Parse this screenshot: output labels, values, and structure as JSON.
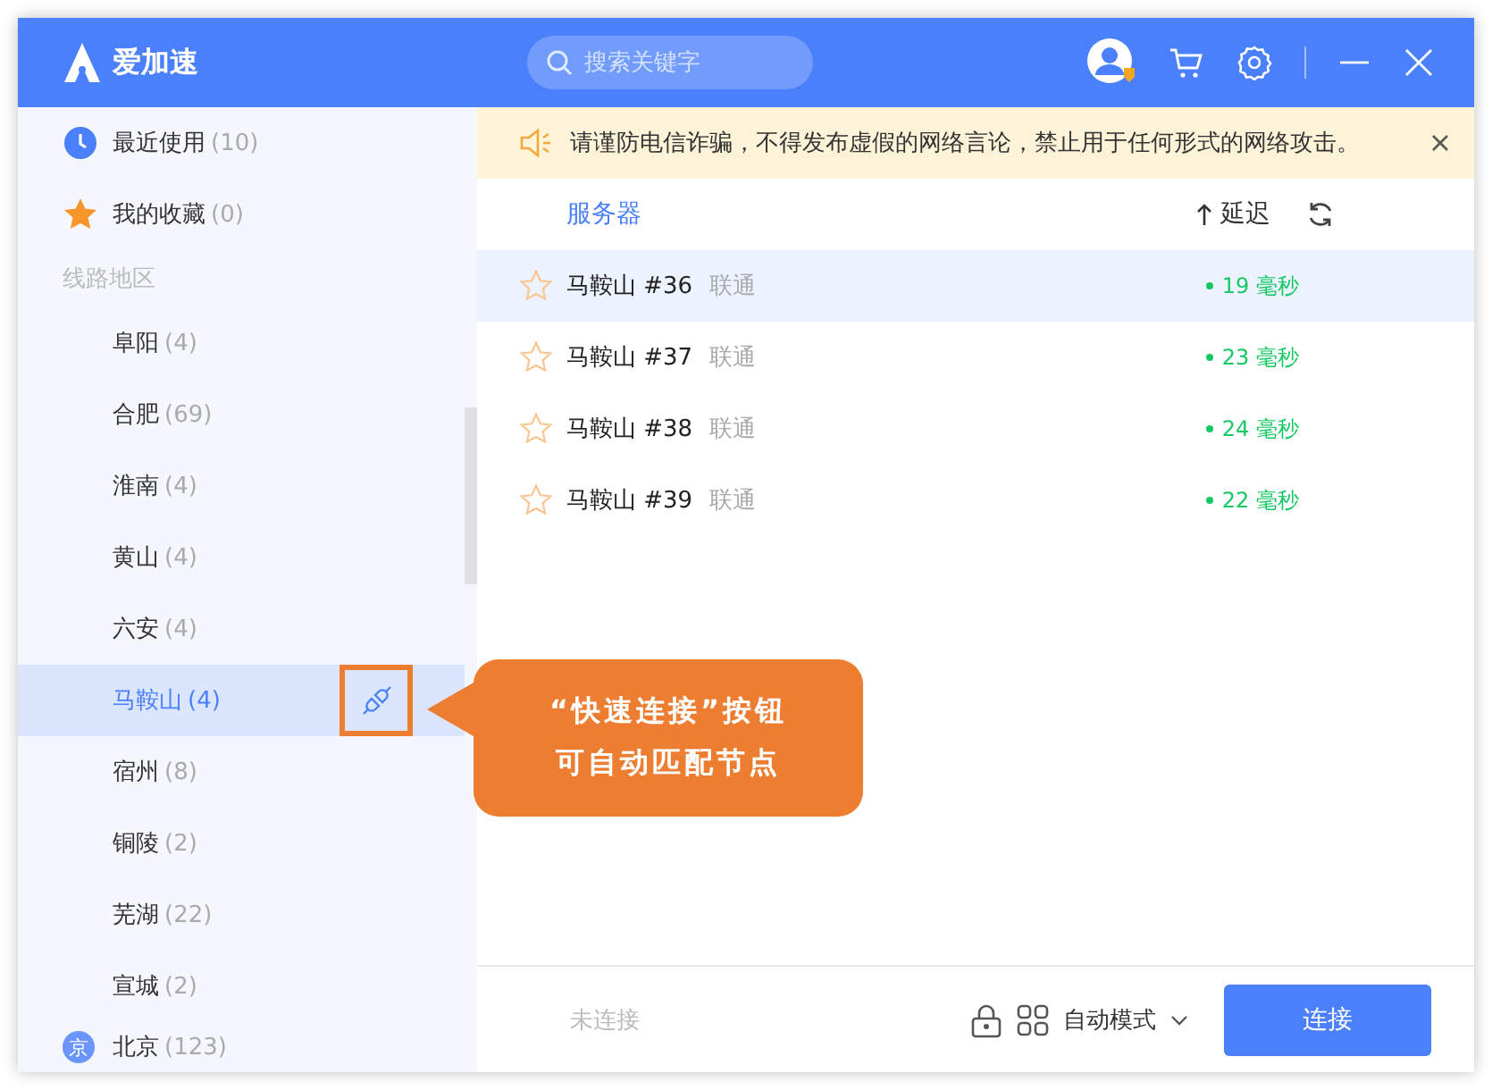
{
  "app": {
    "name": "爱加速"
  },
  "search": {
    "placeholder": "搜索关键字"
  },
  "sidebar": {
    "items": [
      {
        "kind": "recent",
        "label": "最近使用",
        "count": "(10)"
      },
      {
        "kind": "favorite",
        "label": "我的收藏",
        "count": "(0)"
      }
    ],
    "section_label": "线路地区",
    "regions": [
      {
        "label": "阜阳",
        "count": "(4)",
        "selected": false
      },
      {
        "label": "合肥",
        "count": "(69)",
        "selected": false
      },
      {
        "label": "淮南",
        "count": "(4)",
        "selected": false
      },
      {
        "label": "黄山",
        "count": "(4)",
        "selected": false
      },
      {
        "label": "六安",
        "count": "(4)",
        "selected": false
      },
      {
        "label": "马鞍山",
        "count": "(4)",
        "selected": true
      },
      {
        "label": "宿州",
        "count": "(8)",
        "selected": false
      },
      {
        "label": "铜陵",
        "count": "(2)",
        "selected": false
      },
      {
        "label": "芜湖",
        "count": "(22)",
        "selected": false
      },
      {
        "label": "宣城",
        "count": "(2)",
        "selected": false
      }
    ],
    "province": {
      "badge": "京",
      "label": "北京",
      "count": "(123)"
    }
  },
  "notice": {
    "text": "请谨防电信诈骗，不得发布虚假的网络言论，禁止用于任何形式的网络攻击。"
  },
  "table": {
    "columns": [
      "服务器",
      "延迟"
    ],
    "rows": [
      {
        "name": "马鞍山 #36",
        "isp": "联通",
        "latency": "19 毫秒",
        "selected": true,
        "favorite": false
      },
      {
        "name": "马鞍山 #37",
        "isp": "联通",
        "latency": "23 毫秒",
        "selected": false,
        "favorite": false
      },
      {
        "name": "马鞍山 #38",
        "isp": "联通",
        "latency": "24 毫秒",
        "selected": false,
        "favorite": false
      },
      {
        "name": "马鞍山 #39",
        "isp": "联通",
        "latency": "22 毫秒",
        "selected": false,
        "favorite": false
      }
    ]
  },
  "footer": {
    "status": "未连接",
    "mode": "自动模式",
    "button": "连接"
  },
  "callout": {
    "lines": [
      "“快速连接”按钮",
      "可自动匹配节点"
    ]
  }
}
